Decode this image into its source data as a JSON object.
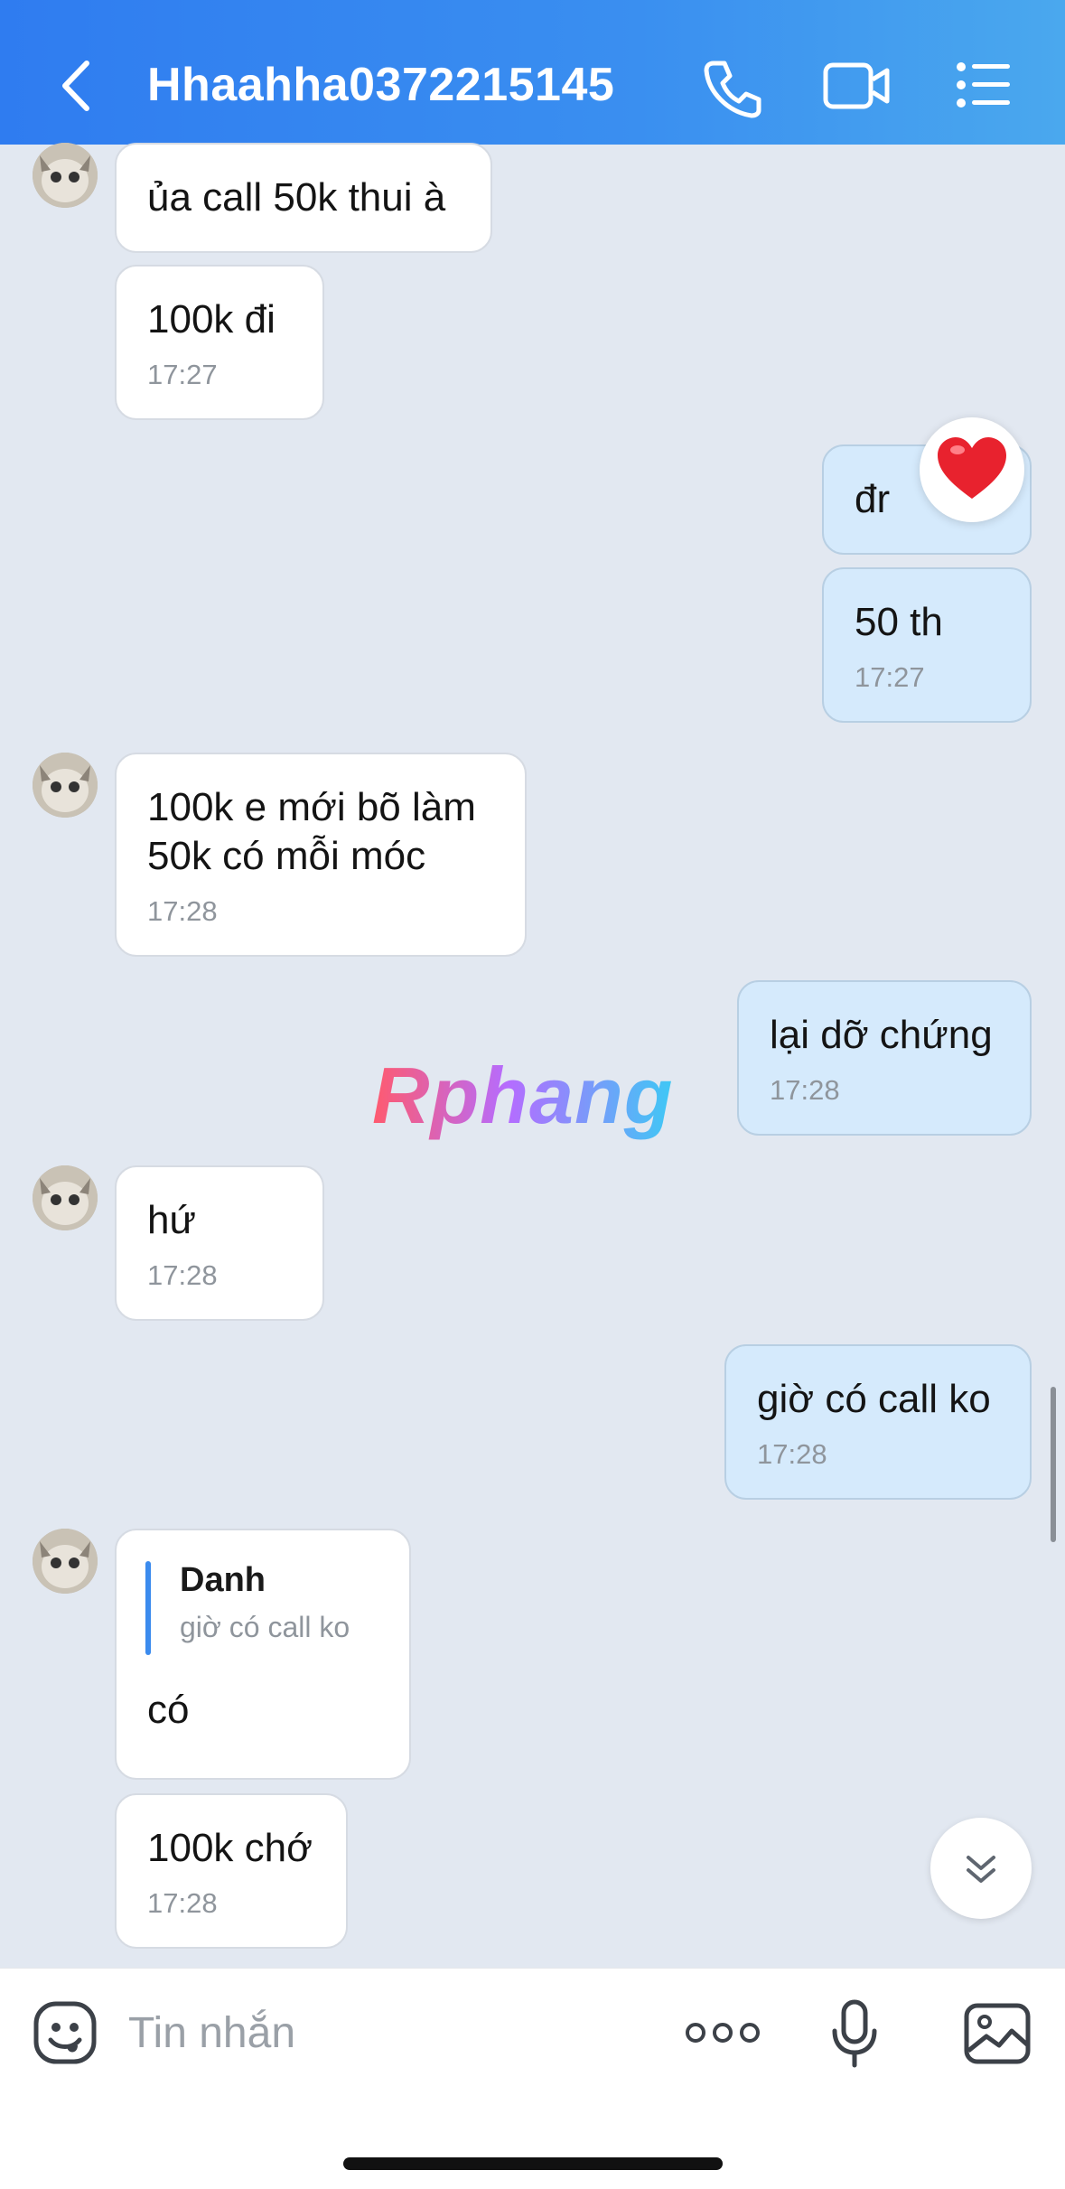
{
  "header": {
    "title": "Hhaahha0372215145",
    "icons": [
      "back-icon",
      "phone-icon",
      "video-icon",
      "menu-icon"
    ]
  },
  "messages": [
    {
      "side": "in",
      "text": "ủa call 50k thui à"
    },
    {
      "side": "in",
      "text": "100k đi",
      "time": "17:27"
    },
    {
      "side": "out",
      "text": "đr",
      "reaction": "heart"
    },
    {
      "side": "out",
      "text": "50 th",
      "time": "17:27"
    },
    {
      "side": "in",
      "text": "100k e mới bõ làm\n50k có mỗi móc",
      "time": "17:28"
    },
    {
      "side": "out",
      "text": "lại dỡ chứng",
      "time": "17:28"
    },
    {
      "side": "in",
      "text": "hứ",
      "time": "17:28"
    },
    {
      "side": "out",
      "text": "giờ có call ko",
      "time": "17:28"
    },
    {
      "side": "in",
      "reply_name": "Danh",
      "reply_text": "giờ có call ko",
      "text": "có"
    },
    {
      "side": "in",
      "text": "100k chớ",
      "time": "17:28"
    }
  ],
  "watermark": "Rphang",
  "input": {
    "placeholder": "Tin nhắn",
    "icons": [
      "sticker-icon",
      "more-icon",
      "mic-icon",
      "image-icon"
    ]
  },
  "colors": {
    "header_start": "#2f7cf0",
    "header_end": "#4aa8ee",
    "chat_bg": "#e2e8f1",
    "incoming_bubble": "#ffffff",
    "outgoing_bubble": "#d5eafc",
    "accent": "#3b8bee"
  }
}
